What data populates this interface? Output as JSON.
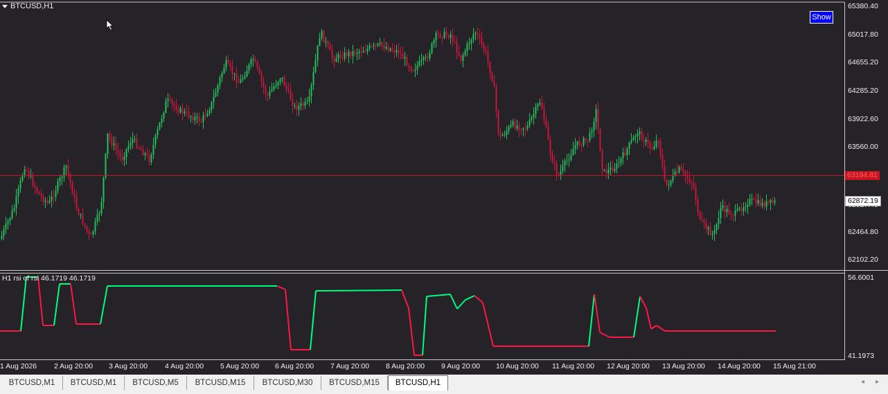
{
  "chart": {
    "symbol": "BTCUSD,H1",
    "show_label": "Show",
    "price_axis": [
      "65380.40",
      "65017.80",
      "64655.20",
      "64285.20",
      "63922.60",
      "63560.00",
      "62464.80",
      "62102.20"
    ],
    "partial_axis": "62827.40",
    "bid_price": "63194.81",
    "last_price": "62872.19",
    "rsi_label": "H1 rsi of rsi  46.1719 46.1719",
    "rsi_max": "56.6001",
    "rsi_min": "41.1973",
    "time_axis": [
      "1 Aug 2026",
      "2 Aug 20:00",
      "3 Aug 20:00",
      "4 Aug 20:00",
      "5 Aug 20:00",
      "6 Aug 20:00",
      "7 Aug 20:00",
      "8 Aug 20:00",
      "9 Aug 20:00",
      "10 Aug 20:00",
      "11 Aug 20:00",
      "12 Aug 20:00",
      "13 Aug 20:00",
      "14 Aug 20:00",
      "15 Aug 21:00"
    ],
    "colors": {
      "bull": "#21c25e",
      "bear": "#c8173c",
      "bid_line": "#c8141e",
      "rsi_up": "#00ff7f",
      "rsi_down": "#ff1744"
    }
  },
  "tabs": [
    {
      "label": "BTCUSD,M1"
    },
    {
      "label": "BTCUSD,M1"
    },
    {
      "label": "BTCUSD,M5"
    },
    {
      "label": "BTCUSD,M15"
    },
    {
      "label": "BTCUSD,M30"
    },
    {
      "label": "BTCUSD,M15"
    },
    {
      "label": "BTCUSD,H1",
      "active": true
    }
  ],
  "icons": {
    "cursor": "arrow-cursor-icon",
    "scroll_left": "chevron-left-icon",
    "scroll_right": "chevron-right-icon"
  }
}
